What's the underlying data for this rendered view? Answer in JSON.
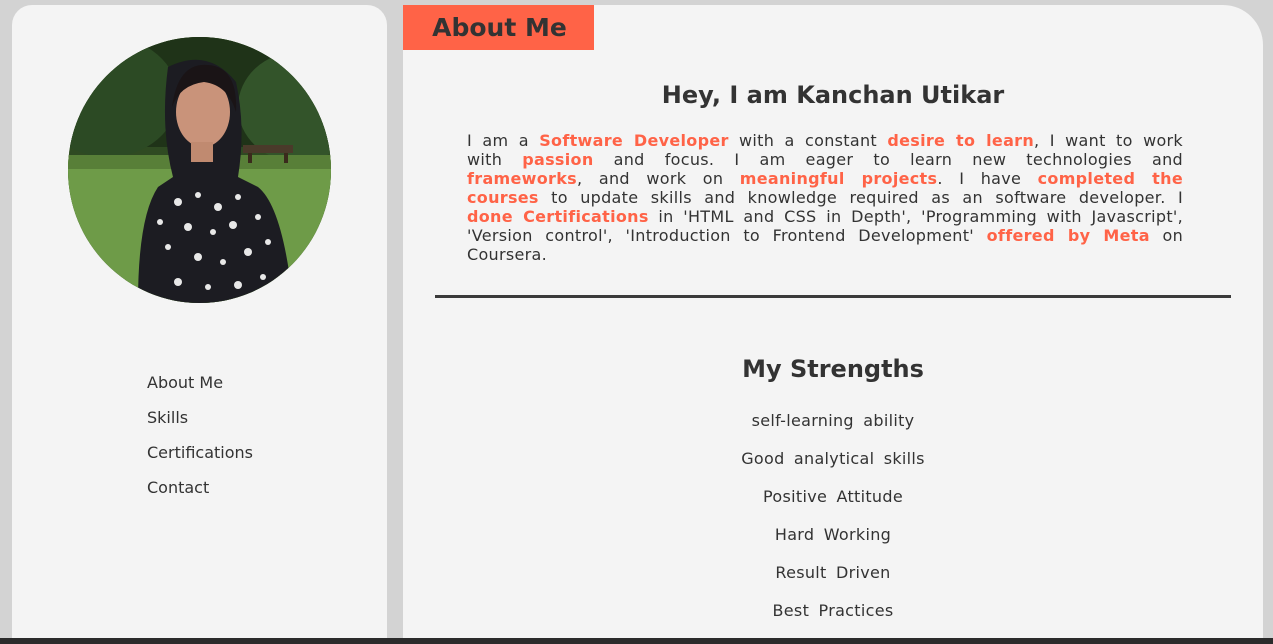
{
  "sidebar": {
    "avatar_alt": "Kanchan Utikar profile photo",
    "nav_items": [
      {
        "label": "About Me"
      },
      {
        "label": "Skills"
      },
      {
        "label": "Certifications"
      },
      {
        "label": "Contact"
      }
    ]
  },
  "main": {
    "section_tab": "About Me",
    "intro_heading": "Hey, I am Kanchan Utikar",
    "intro": {
      "t1": "I am a ",
      "h1": "Software Developer",
      "t2": " with a constant ",
      "h2": "desire to learn",
      "t3": ", I want to work with ",
      "h3": "passion",
      "t4": " and focus. I am eager to learn new technologies and ",
      "h4": "frameworks",
      "t5": ", and work on ",
      "h5": "meaningful projects",
      "t6": ". I have ",
      "h6": "completed the courses",
      "t7": " to update skills and knowledge required as an software developer. I ",
      "h7": "done Certifications",
      "t8": " in 'HTML and CSS in Depth', 'Programming with Javascript', 'Version control', 'Introduction to Frontend Development' ",
      "h8": "offered by Meta",
      "t9": " on Coursera."
    },
    "strengths_heading": "My Strengths",
    "strengths": [
      "self-learning ability",
      "Good analytical skills",
      "Positive Attitude",
      "Hard Working",
      "Result Driven",
      "Best Practices"
    ]
  },
  "colors": {
    "accent": "#ff6347",
    "panel": "#f4f4f4",
    "background": "#d3d3d3",
    "text": "#333333"
  }
}
